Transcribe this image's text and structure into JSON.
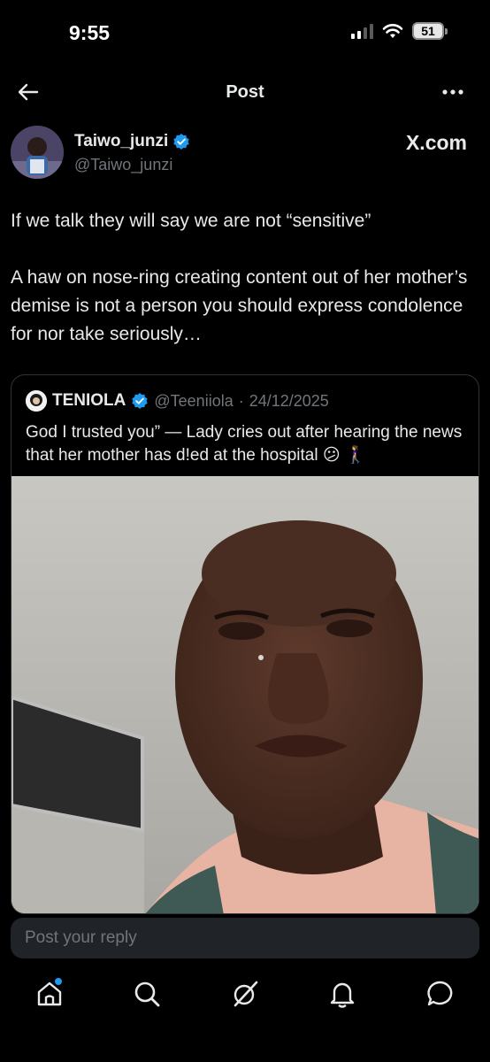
{
  "status_bar": {
    "time": "9:55",
    "battery": "51"
  },
  "nav": {
    "title": "Post"
  },
  "author": {
    "display_name": "Taiwo_junzi",
    "handle": "@Taiwo_junzi",
    "source_link": "X.com",
    "verified": true
  },
  "post": {
    "paragraph_1": "If we talk they will say we are not “sensitive”",
    "paragraph_2": "A haw on nose-ring creating content out of her mother’s demise is not a person you should express condolence for nor take seriously…"
  },
  "quote": {
    "name": "TENIOLA",
    "handle": "@Teeniiola",
    "separator": "·",
    "date": "24/12/2025",
    "text": "God I trusted you” — Lady cries out after hearing the news that her mother has d!ed at the hospital 😕 🚶‍♀️",
    "media_icon": "video-still"
  },
  "reply": {
    "placeholder": "Post your reply"
  },
  "tabbar": {
    "items": [
      "home-icon",
      "search-icon",
      "grok-icon",
      "notifications-icon",
      "messages-icon"
    ],
    "accent": "#1d9bf0"
  },
  "colors": {
    "background": "#000000",
    "text": "#e7e9ea",
    "secondary": "#71767b",
    "verified": "#1d9bf0",
    "border": "#2f3336"
  }
}
